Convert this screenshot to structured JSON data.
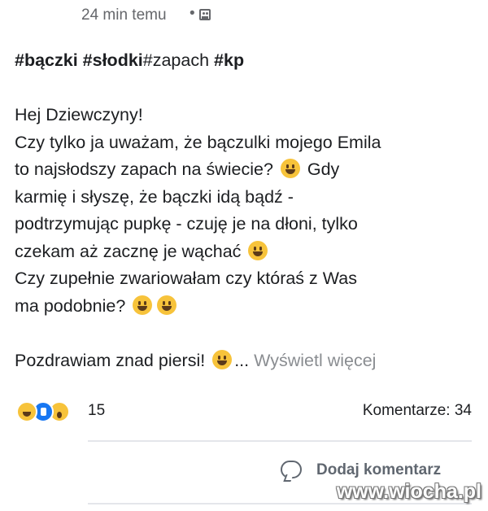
{
  "meta": {
    "time": "24 min temu",
    "separator": "•",
    "audience_icon": "group-icon"
  },
  "post": {
    "hashtags": {
      "tag1": "#bączki",
      "tag2": "#słodki",
      "tag3": "#zapach",
      "tag4": "#kp"
    },
    "lines": [
      "Hej Dziewczyny!",
      "Czy tylko ja uważam, że bączulki mojego Emila",
      "to najsłodszy zapach na świecie?",
      "Gdy",
      "karmię i słyszę, że bączki idą bądź -",
      "podtrzymując pupkę - czuję je na dłoni, tylko",
      "czekam aż zacznę je wąchać",
      "Czy zupełnie zwariowałam czy któraś z Was",
      "ma podobnie?",
      "Pozdrawiam znad piersi!"
    ],
    "ellipsis": "...",
    "see_more": "Wyświetl więcej"
  },
  "reactions": {
    "icons": [
      "haha-icon",
      "like-icon",
      "wow-icon"
    ],
    "count": "15",
    "comments": "Komentarze: 34"
  },
  "actions": {
    "comment_label": "Dodaj komentarz",
    "comment_icon": "comment-bubble-icon"
  },
  "watermark": "www.wiocha.pl"
}
